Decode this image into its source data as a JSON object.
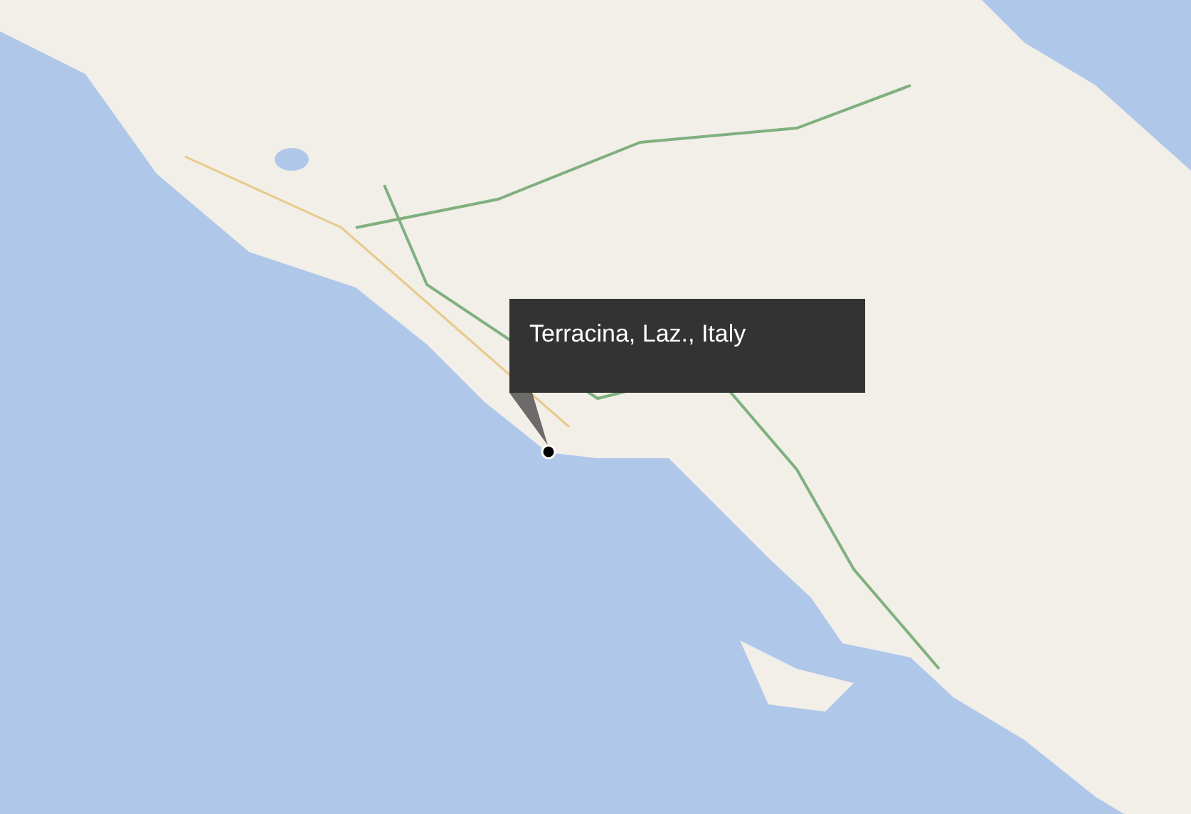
{
  "map": {
    "callout": {
      "title": "Terracina, Laz., Italy"
    }
  }
}
